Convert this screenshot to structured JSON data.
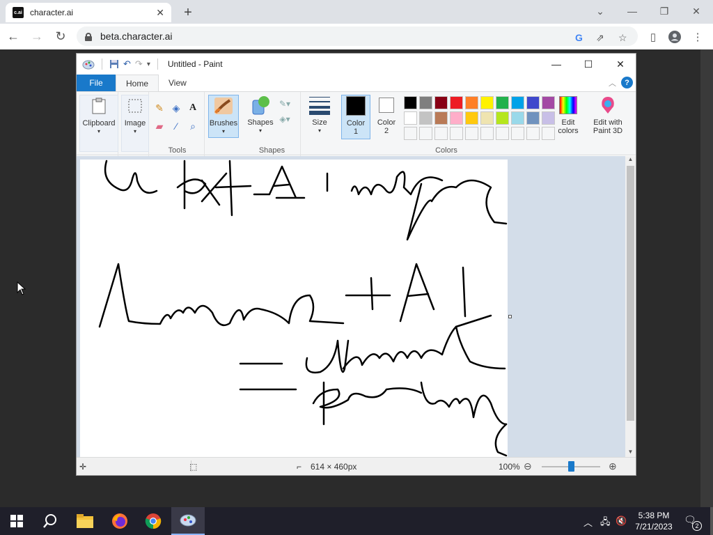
{
  "browser": {
    "tab_title": "character.ai",
    "favicon_text": "c.ai",
    "url": "beta.character.ai"
  },
  "paint": {
    "window_title": "Untitled - Paint",
    "tabs": {
      "file": "File",
      "home": "Home",
      "view": "View"
    },
    "help": "?",
    "groups": {
      "clipboard": "Clipboard",
      "image": "Image",
      "tools": "Tools",
      "brushes": "Brushes",
      "shapes": "Shapes",
      "shapes_group": "Shapes",
      "size": "Size",
      "color1": "Color 1",
      "color2": "Color 2",
      "colors": "Colors",
      "edit_colors": "Edit colors",
      "edit_paint3d": "Edit with Paint 3D"
    },
    "palette_row1": [
      "#000000",
      "#7f7f7f",
      "#880015",
      "#ed1c24",
      "#ff7f27",
      "#fff200",
      "#22b14c",
      "#00a2e8",
      "#3f48cc",
      "#a349a4"
    ],
    "palette_row2": [
      "#ffffff",
      "#c3c3c3",
      "#b97a57",
      "#ffaec9",
      "#ffc90e",
      "#efe4b0",
      "#b5e61d",
      "#99d9ea",
      "#7092be",
      "#c8bfe7"
    ],
    "status": {
      "canvas_size": "614 × 460px",
      "zoom": "100%"
    }
  },
  "taskbar": {
    "time": "5:38 PM",
    "date": "7/21/2023",
    "notifications": "2"
  }
}
